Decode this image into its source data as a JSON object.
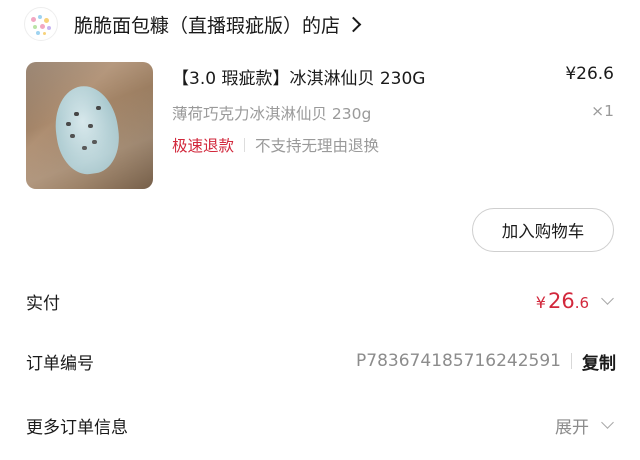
{
  "store": {
    "name": "脆脆面包糠（直播瑕疵版）的店"
  },
  "product": {
    "title": "【3.0 瑕疵款】冰淇淋仙贝 230G",
    "price": "¥26.6",
    "spec": "薄荷巧克力冰淇淋仙贝 230g",
    "quantity": "×1",
    "tags": {
      "fast_refund": "极速退款",
      "no_return": "不支持无理由退换"
    },
    "add_to_cart_label": "加入购物车"
  },
  "order": {
    "paid_label": "实付",
    "paid_currency": "¥",
    "paid_integer": "26",
    "paid_decimal": ".6",
    "number_label": "订单编号",
    "number_value": "P783674185716242591",
    "copy_label": "复制",
    "more_label": "更多订单信息",
    "expand_label": "展开"
  },
  "icons": {
    "store_avatar": "store-avatar-icon",
    "store_chevron": "chevron-right-icon",
    "paid_chevron": "chevron-down-icon",
    "more_chevron": "chevron-down-icon"
  },
  "colors": {
    "accent_red": "#d2283c",
    "secondary_text": "#9a9a9a",
    "primary_text": "#1a1a1a"
  }
}
